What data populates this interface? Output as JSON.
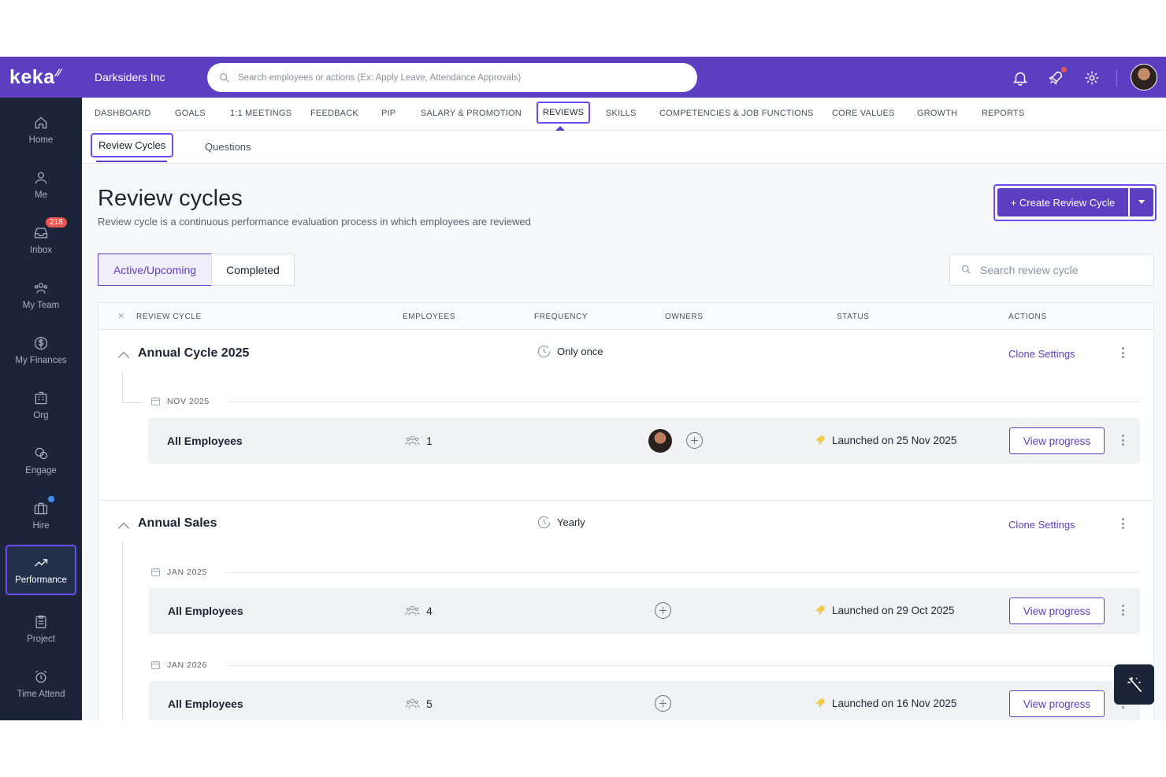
{
  "brand": {
    "logo": "keka",
    "company": "Darksiders Inc"
  },
  "topbar": {
    "search_placeholder": "Search employees or actions (Ex: Apply Leave, Attendance Approvals)"
  },
  "sidebar": {
    "items": [
      {
        "label": "Home",
        "icon": "home-icon"
      },
      {
        "label": "Me",
        "icon": "user-icon"
      },
      {
        "label": "Inbox",
        "icon": "inbox-icon",
        "badge": "218"
      },
      {
        "label": "My Team",
        "icon": "team-icon"
      },
      {
        "label": "My Finances",
        "icon": "dollar-icon"
      },
      {
        "label": "Org",
        "icon": "org-icon"
      },
      {
        "label": "Engage",
        "icon": "engage-icon"
      },
      {
        "label": "Hire",
        "icon": "briefcase-icon"
      },
      {
        "label": "Performance",
        "icon": "trend-icon"
      },
      {
        "label": "Project",
        "icon": "clipboard-icon"
      },
      {
        "label": "Time Attend",
        "icon": "alarm-icon"
      }
    ]
  },
  "tabs": [
    "DASHBOARD",
    "GOALS",
    "1:1 MEETINGS",
    "FEEDBACK",
    "PIP",
    "SALARY & PROMOTION",
    "REVIEWS",
    "SKILLS",
    "COMPETENCIES & JOB FUNCTIONS",
    "CORE VALUES",
    "GROWTH",
    "REPORTS"
  ],
  "subtabs": [
    "Review Cycles",
    "Questions"
  ],
  "page": {
    "title": "Review cycles",
    "subtitle": "Review cycle is a continuous performance evaluation process in which employees are reviewed",
    "create_label": "+ Create Review Cycle",
    "filter_active": "Active/Upcoming",
    "filter_completed": "Completed",
    "search_placeholder": "Search review cycle"
  },
  "table": {
    "headers": [
      "REVIEW CYCLE",
      "EMPLOYEES",
      "FREQUENCY",
      "OWNERS",
      "STATUS",
      "ACTIONS"
    ],
    "clone_label": "Clone Settings",
    "view_label": "View progress",
    "groups": [
      {
        "name": "Annual Cycle 2025",
        "frequency": "Only once",
        "periods": [
          {
            "date": "NOV 2025",
            "row": {
              "name": "All Employees",
              "employees": "1",
              "status": "Launched on 25 Nov 2025"
            }
          }
        ]
      },
      {
        "name": "Annual Sales",
        "frequency": "Yearly",
        "periods": [
          {
            "date": "JAN 2025",
            "row": {
              "name": "All Employees",
              "employees": "4",
              "status": "Launched on 29 Oct 2025"
            }
          },
          {
            "date": "JAN 2026",
            "row": {
              "name": "All Employees",
              "employees": "5",
              "status": "Launched on 16 Nov 2025"
            }
          }
        ]
      }
    ]
  },
  "colors": {
    "primary": "#5b3fc0",
    "sidebar": "#1b2438",
    "highlight": "#6e4bf0",
    "badge": "#e8544e"
  }
}
